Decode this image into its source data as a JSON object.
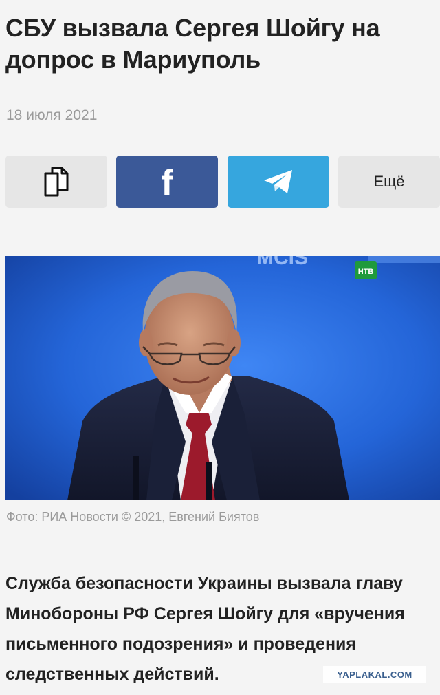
{
  "article": {
    "title": "СБУ вызвала Сергея Шойгу на допрос в Мариуполь",
    "date": "18 июля 2021",
    "photo_caption": "Фото: РИА Новости © 2021, Евгений Биятов",
    "lead": "Служба безопасности Украины вызвала главу Минобороны РФ Сергея Шойгу для «вручения письменного подозрения» и проведения следственных действий."
  },
  "share": {
    "copy_icon": "copy-icon",
    "facebook_icon": "facebook-icon",
    "telegram_icon": "telegram-icon",
    "more_label": "Ещё",
    "colors": {
      "facebook": "#3b5998",
      "telegram": "#36a6de",
      "neutral": "#e6e6e6"
    }
  },
  "photo": {
    "backdrop_text": "MCIS",
    "channel_logo": "НТВ",
    "channel_logo_icon": "ntv-logo-icon"
  },
  "watermark": {
    "text": "YAPLAKAL.COM"
  }
}
